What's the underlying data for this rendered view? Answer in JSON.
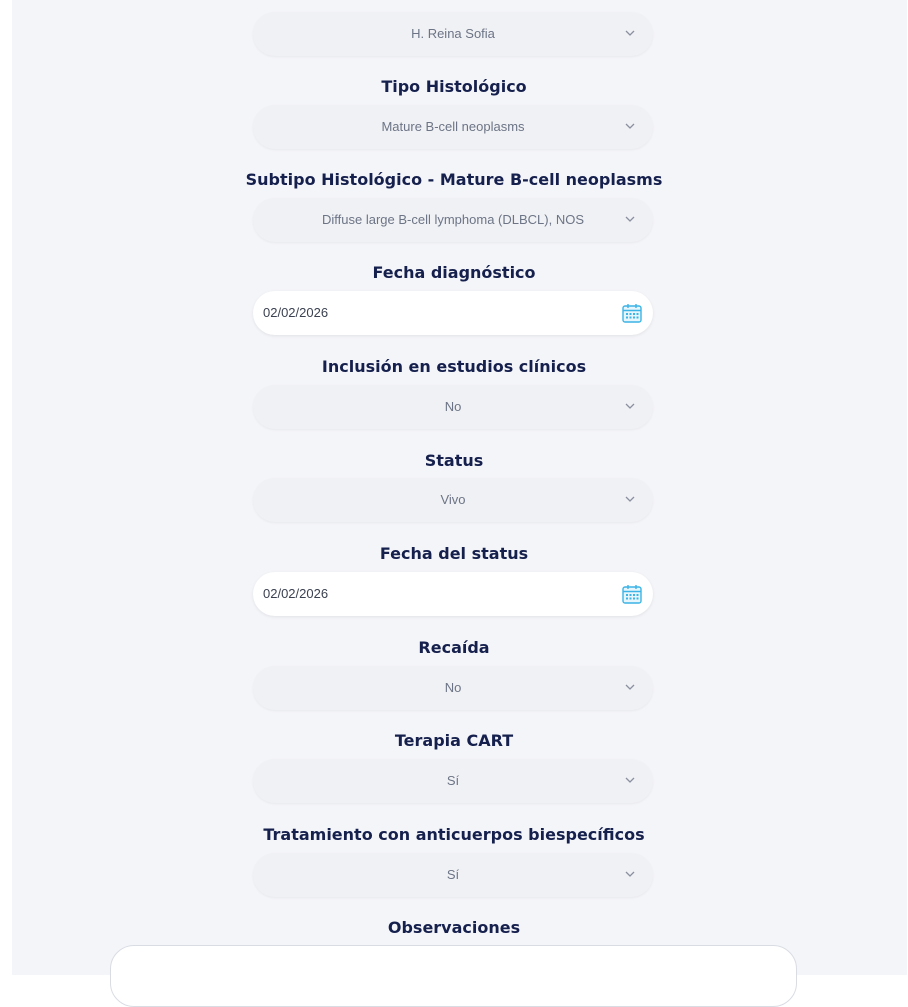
{
  "form": {
    "hospital": {
      "value": "H. Reina Sofia"
    },
    "tipo_histologico": {
      "label": "Tipo Histológico",
      "value": "Mature B-cell neoplasms"
    },
    "subtipo_histologico": {
      "label": "Subtipo Histológico - Mature B-cell neoplasms",
      "value": "Diffuse large B-cell lymphoma (DLBCL), NOS"
    },
    "fecha_diagnostico": {
      "label": "Fecha diagnóstico",
      "value": "02/02/2026"
    },
    "inclusion_estudios": {
      "label": "Inclusión en estudios clínicos",
      "value": "No"
    },
    "status": {
      "label": "Status",
      "value": "Vivo"
    },
    "fecha_status": {
      "label": "Fecha del status",
      "value": "02/02/2026"
    },
    "recaida": {
      "label": "Recaída",
      "value": "No"
    },
    "terapia_cart": {
      "label": "Terapia CART",
      "value": "Sí"
    },
    "anticuerpos": {
      "label": "Tratamiento con anticuerpos biespecíficos",
      "value": "Sí"
    },
    "observaciones": {
      "label": "Observaciones",
      "value": ""
    }
  },
  "icons": {
    "select_chevron": "chevron-down-icon",
    "date_picker": "calendar-icon"
  },
  "colors": {
    "label_text": "#16204d",
    "field_bg": "#f0f1f4",
    "calendar_accent": "#3cb4e6"
  }
}
